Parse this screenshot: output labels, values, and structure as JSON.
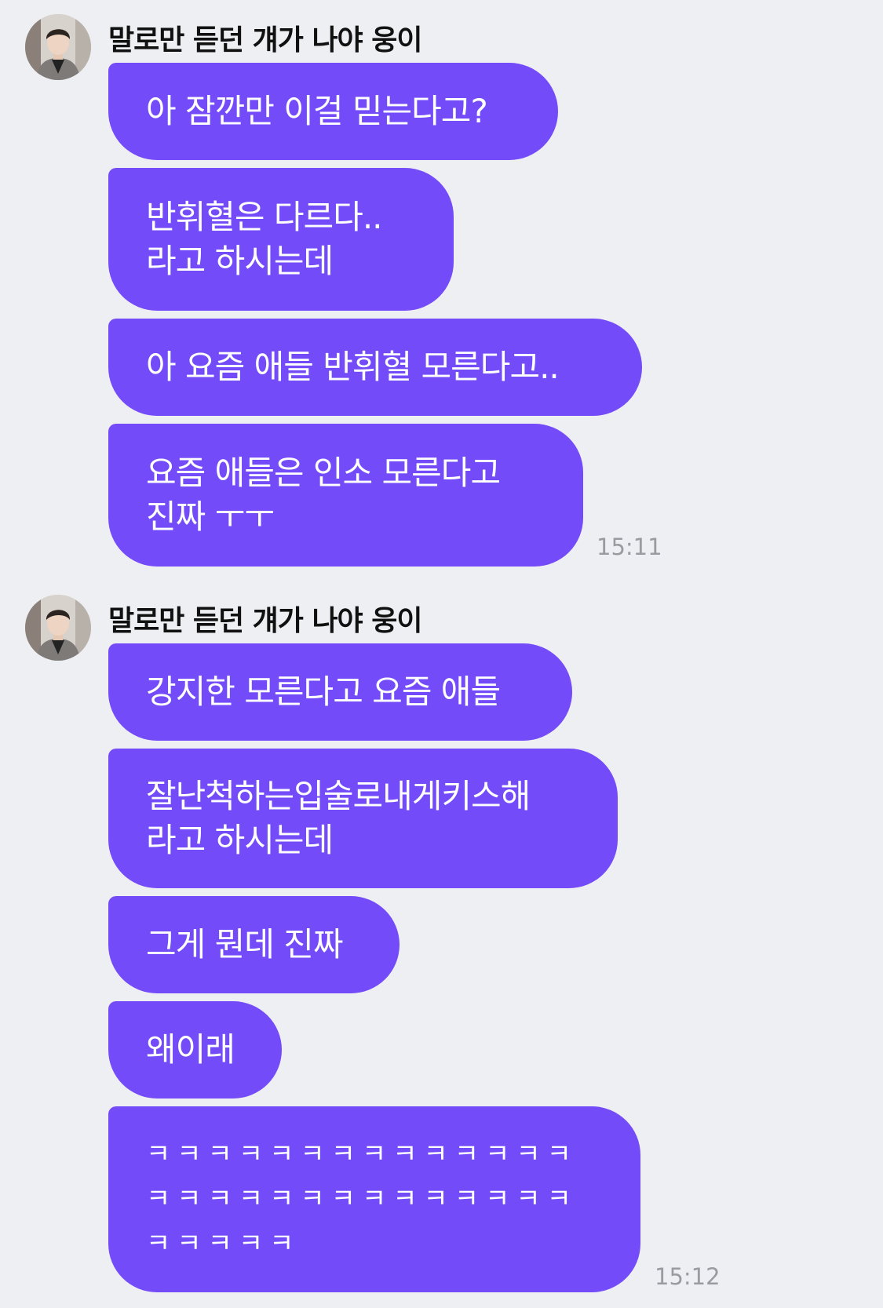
{
  "colors": {
    "background": "#eeeff3",
    "bubble": "#744bf8",
    "bubble_text": "#ffffff",
    "timestamp": "#9a9ba1"
  },
  "messages": [
    {
      "sender": "말로만 듣던 걔가 나야 웅이",
      "avatar": "profile-photo",
      "bubbles": [
        {
          "lines": [
            "아 잠깐만 이걸 믿는다고?"
          ]
        },
        {
          "lines": [
            "반휘혈은 다르다..",
            "라고 하시는데"
          ]
        },
        {
          "lines": [
            "아 요즘 애들 반휘혈 모른다고.."
          ]
        },
        {
          "lines": [
            "요즘 애들은 인소 모른다고",
            "진짜 ㅜㅜ"
          ]
        }
      ],
      "time": "15:11"
    },
    {
      "sender": "말로만 듣던 걔가 나야 웅이",
      "avatar": "profile-photo",
      "bubbles": [
        {
          "lines": [
            "강지한 모른다고 요즘 애들"
          ]
        },
        {
          "lines": [
            "잘난척하는입술로내게키스해",
            "라고 하시는데"
          ]
        },
        {
          "lines": [
            "그게 뭔데 진짜"
          ]
        },
        {
          "lines": [
            "왜이래"
          ]
        },
        {
          "lines": [
            "ㅋㅋㅋㅋㅋㅋㅋㅋㅋㅋㅋㅋㅋㅋ",
            "ㅋㅋㅋㅋㅋㅋㅋㅋㅋㅋㅋㅋㅋㅋ",
            "ㅋㅋㅋㅋㅋ"
          ]
        }
      ],
      "time": "15:12"
    }
  ]
}
